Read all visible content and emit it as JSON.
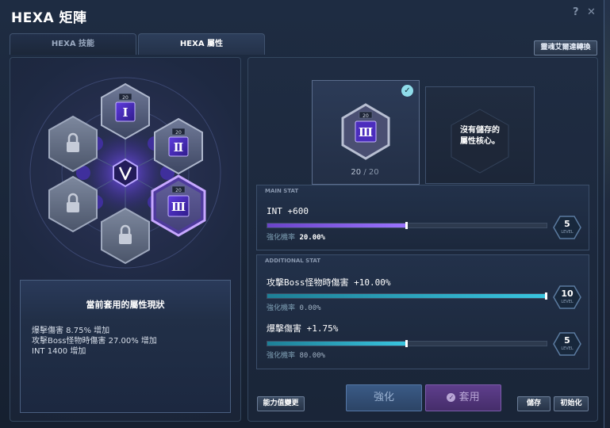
{
  "window": {
    "title": "HEXA 矩陣",
    "help_label": "?",
    "close_label": "✕"
  },
  "tabs": [
    {
      "label": "HEXA 技能",
      "active": false
    },
    {
      "label": "HEXA 屬性",
      "active": true
    }
  ],
  "convert_button": "靈魂艾爾達轉換",
  "hex_grid": {
    "center_icon": "v-matrix-icon",
    "cells": [
      {
        "state": "unlocked",
        "level": "20",
        "numeral": "Ⅰ"
      },
      {
        "state": "locked",
        "icon": "lock-icon"
      },
      {
        "state": "unlocked",
        "level": "20",
        "numeral": "Ⅱ"
      },
      {
        "state": "unlocked",
        "level": "20",
        "numeral": "Ⅲ",
        "selected": true
      },
      {
        "state": "locked",
        "icon": "lock-icon"
      },
      {
        "state": "locked",
        "icon": "lock-icon"
      }
    ]
  },
  "status": {
    "title": "當前套用的屬性現狀",
    "lines": [
      "爆擊傷害 8.75% 增加",
      "攻擊Boss怪物時傷害 27.00% 增加",
      "INT 1400 增加"
    ]
  },
  "core_card": {
    "level": "20",
    "numeral": "Ⅲ",
    "count_current": "20",
    "count_separator": "/",
    "count_max": "20"
  },
  "empty_card": {
    "line1": "沒有儲存的",
    "line2": "屬性核心。"
  },
  "main_stat": {
    "header": "MAIN STAT",
    "name": "INT +600",
    "progress": 0.5,
    "prob_label": "強化機率",
    "prob_value": "20.00%",
    "level": "5",
    "level_word": "LEVEL"
  },
  "additional_stat": {
    "header": "ADDITIONAL STAT",
    "stats": [
      {
        "name": "攻擊Boss怪物時傷害 +10.00%",
        "progress": 1.0,
        "prob_label": "強化機率",
        "prob_value": "0.00%",
        "level": "10",
        "level_word": "LEVEL"
      },
      {
        "name": "爆擊傷害 +1.75%",
        "progress": 0.5,
        "prob_label": "強化機率",
        "prob_value": "80.00%",
        "level": "5",
        "level_word": "LEVEL"
      }
    ]
  },
  "buttons": {
    "reroll": "能力值變更",
    "enhance": "強化",
    "apply": "套用",
    "save": "儲存",
    "reset": "初始化"
  },
  "colors": {
    "accent_purple": "#8a5cff",
    "accent_cyan": "#39c6e0",
    "panel_bg": "#1c283c"
  }
}
